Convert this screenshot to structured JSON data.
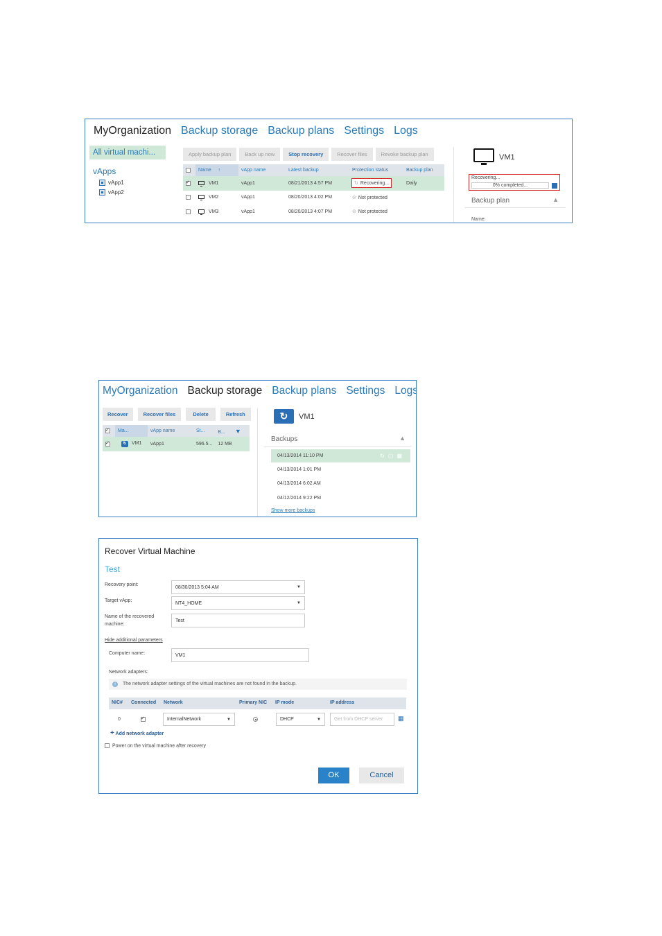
{
  "shot1": {
    "nav": [
      "MyOrganization",
      "Backup storage",
      "Backup plans",
      "Settings",
      "Logs"
    ],
    "sidebar": {
      "all_vms": "All virtual machi...",
      "vapps_title": "vApps",
      "vapps": [
        "vApp1",
        "vApp2"
      ]
    },
    "toolbar": [
      "Apply backup plan",
      "Back up now",
      "Stop recovery",
      "Recover files",
      "Revoke backup plan"
    ],
    "columns": [
      "Name",
      "vApp name",
      "Latest backup",
      "Protection status",
      "Backup plan"
    ],
    "sort_icon": "↑",
    "rows": [
      {
        "name": "VM1",
        "vapp": "vApp1",
        "latest": "08/21/2013 4:57 PM",
        "status": "Recovering...",
        "plan": "Daily",
        "selected": true
      },
      {
        "name": "VM2",
        "vapp": "vApp1",
        "latest": "08/20/2013 4:02 PM",
        "status": "Not protected",
        "plan": "",
        "selected": false
      },
      {
        "name": "VM3",
        "vapp": "vApp1",
        "latest": "08/20/2013 4:07 PM",
        "status": "Not protected",
        "plan": "",
        "selected": false
      }
    ],
    "detail": {
      "vm_name": "VM1",
      "progress_label": "Recovering...",
      "progress_text": "0% completed...",
      "progress": 0,
      "section": "Backup plan",
      "name_label": "Name:"
    }
  },
  "shot2": {
    "nav": [
      "MyOrganization",
      "Backup storage",
      "Backup plans",
      "Settings",
      "Logs"
    ],
    "toolbar": [
      "Recover",
      "Recover files",
      "Delete",
      "Refresh"
    ],
    "columns": [
      "Ma...",
      "vApp name",
      "St...",
      "B..."
    ],
    "row": {
      "name": "VM1",
      "vapp": "vApp1",
      "st": "596.5...",
      "b": "12 MB"
    },
    "detail": {
      "vm_name": "VM1",
      "section": "Backups",
      "backups": [
        "04/13/2014 11:10 PM",
        "04/13/2014 1:01 PM",
        "04/13/2014 6:02 AM",
        "04/12/2014 9:22 PM"
      ],
      "show_more": "Show more backups"
    }
  },
  "shot3": {
    "title": "Recover Virtual Machine",
    "subtitle": "Test",
    "fields": {
      "recovery_point_label": "Recovery point:",
      "recovery_point": "08/30/2013 5:04 AM",
      "target_vapp_label": "Target vApp:",
      "target_vapp": "NT4_HOME",
      "name_label_1": "Name of the recovered",
      "name_label_2": "machine:",
      "name": "Test",
      "hide_link": "Hide additional parameters",
      "computer_name_label": "Computer name:",
      "computer_name": "VM1",
      "network_adapters_label": "Network adapters:"
    },
    "info": "The network adapter settings of the virtual machines are not found in the backup.",
    "nic_columns": [
      "NIC#",
      "Connected",
      "Network",
      "Primary NIC",
      "IP mode",
      "IP address"
    ],
    "nic_row": {
      "nic": "0",
      "network": "InternalNetwork",
      "ip_mode": "DHCP",
      "ip_placeholder": "Get from DHCP server"
    },
    "add_adapter": "Add network adapter",
    "power_on": "Power on the virtual machine after recovery",
    "ok": "OK",
    "cancel": "Cancel"
  },
  "colors": {
    "accent": "#2a7ab8",
    "selection": "#cfe8d8",
    "highlight": "#d32b2b",
    "ok_button": "#2a82c9"
  }
}
